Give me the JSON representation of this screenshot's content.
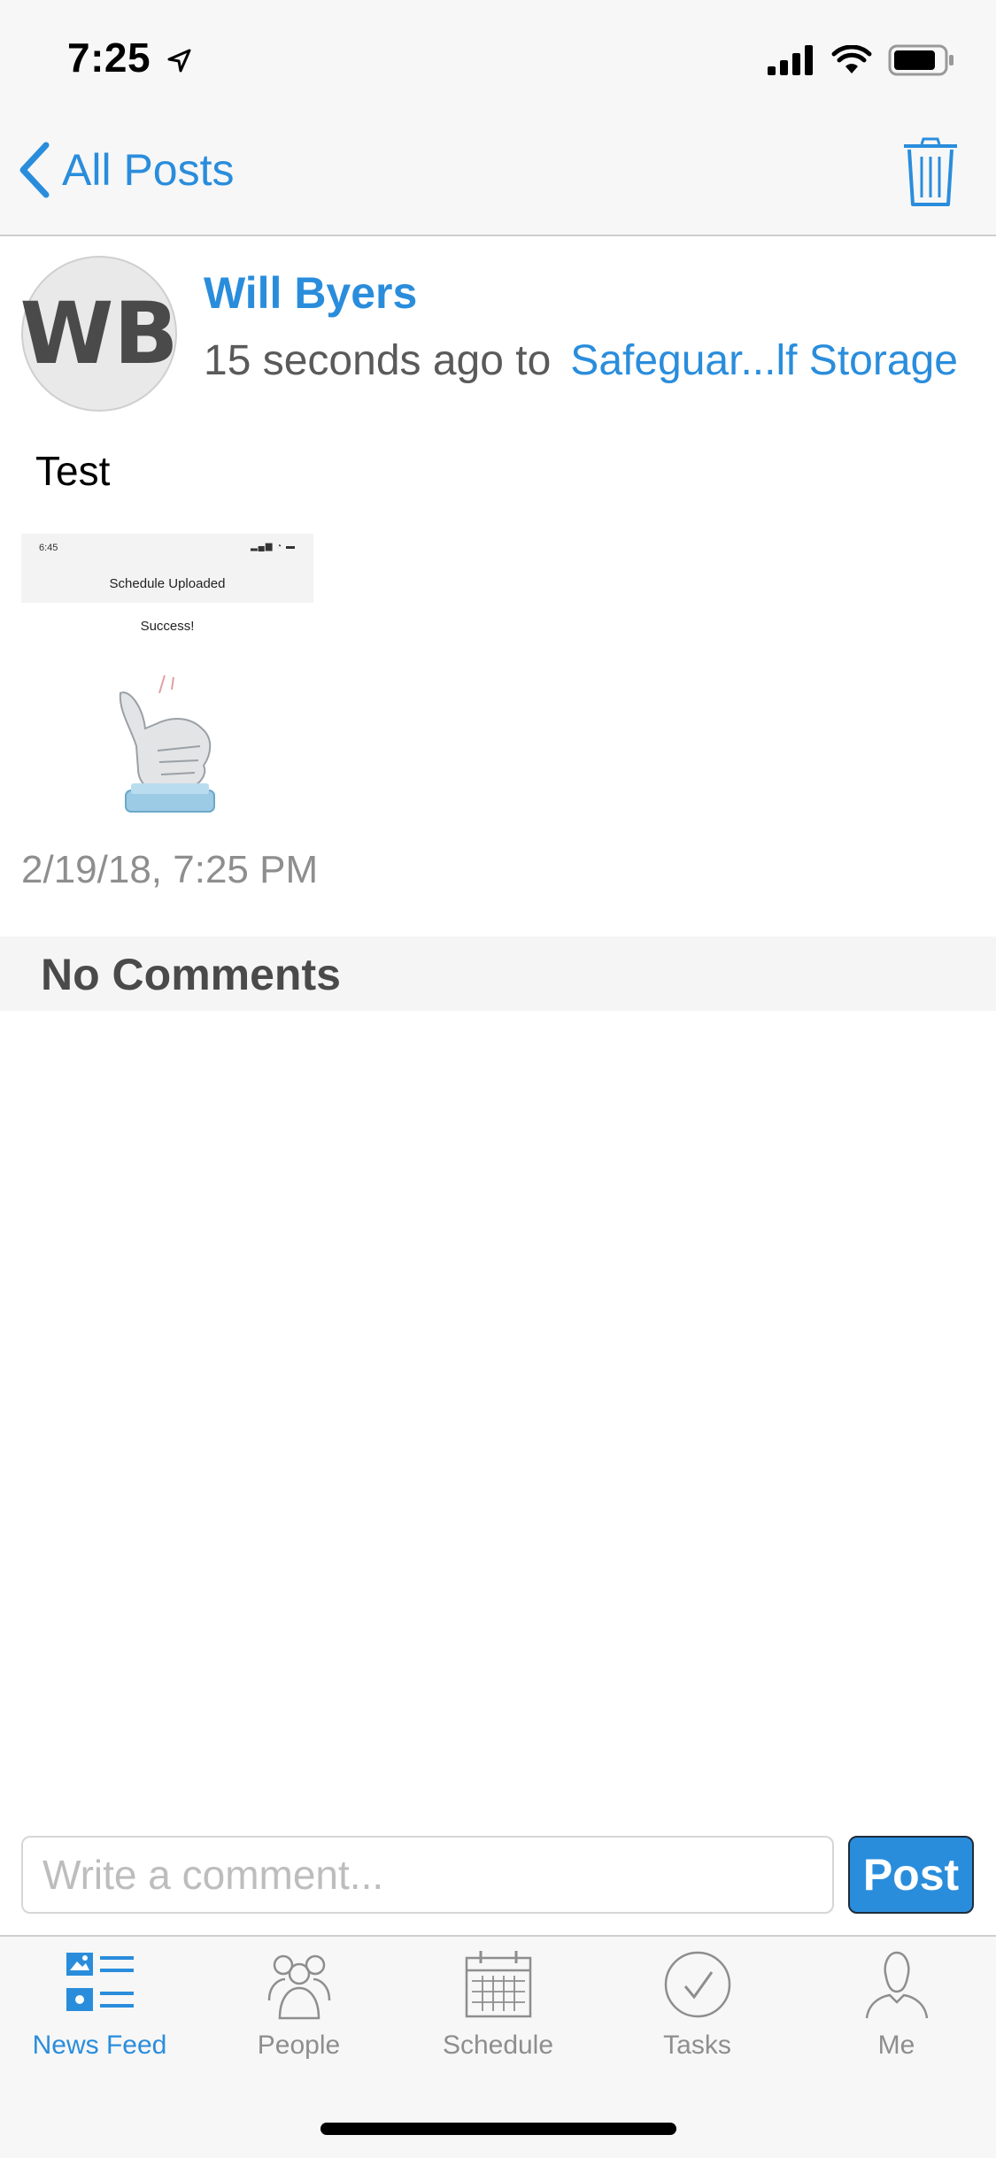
{
  "status_bar": {
    "time": "7:25"
  },
  "nav": {
    "back_label": "All Posts"
  },
  "post": {
    "avatar_initials": "WB",
    "author": "Will Byers",
    "time_ago": "15 seconds ago to",
    "group": "Safeguar...lf Storage",
    "body": "Test",
    "attachment": {
      "status_time": "6:45",
      "title": "Schedule Uploaded",
      "message": "Success!"
    },
    "date": "2/19/18, 7:25 PM"
  },
  "comments": {
    "header": "No Comments"
  },
  "composer": {
    "placeholder": "Write a comment...",
    "post_label": "Post"
  },
  "tabs": [
    {
      "label": "News Feed",
      "icon": "news-feed-icon",
      "active": true
    },
    {
      "label": "People",
      "icon": "people-icon",
      "active": false
    },
    {
      "label": "Schedule",
      "icon": "calendar-icon",
      "active": false
    },
    {
      "label": "Tasks",
      "icon": "checkmark-circle-icon",
      "active": false
    },
    {
      "label": "Me",
      "icon": "person-icon",
      "active": false
    }
  ],
  "colors": {
    "accent": "#2a8ddc",
    "muted": "#8e8e8e",
    "bar_bg": "#f7f7f7"
  }
}
